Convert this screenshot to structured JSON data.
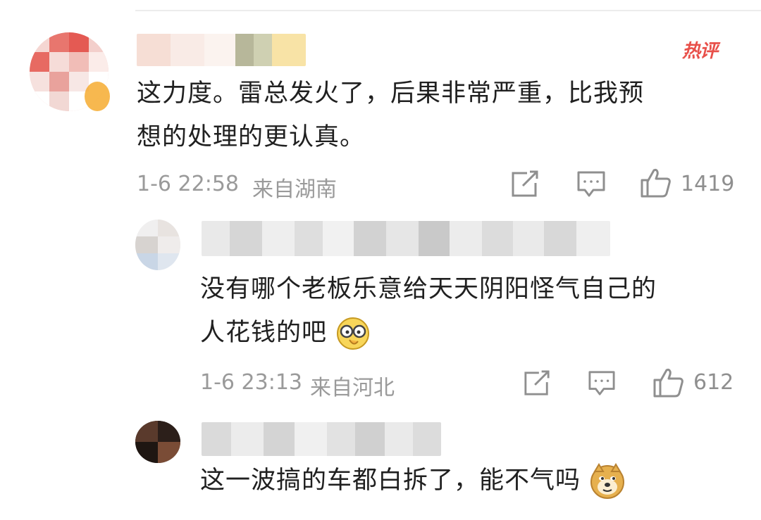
{
  "comments": [
    {
      "badge": "热评",
      "text_line1": "这力度。雷总发火了，后果非常严重，比我预",
      "text_line2": "想的处理的更认真。",
      "time": "1-6 22:58",
      "location": "来自湖南",
      "likes": "1419"
    },
    {
      "text_line1": "没有哪个老板乐意给天天阴阳怪气自己的",
      "text_line2": "人花钱的吧",
      "emoji": "thinking-glasses-emoji",
      "time": "1-6 23:13",
      "location": "来自河北",
      "likes": "612"
    },
    {
      "text_line1": "这一波搞的车都白拆了，能不气吗",
      "emoji": "doge-emoji"
    }
  ],
  "icons": {
    "share": "share-icon",
    "comment": "comment-icon",
    "like": "thumbs-up-icon"
  },
  "colors": {
    "accent_hot": "#e8504a",
    "meta_gray": "#9a9a9a",
    "text": "#202020"
  }
}
